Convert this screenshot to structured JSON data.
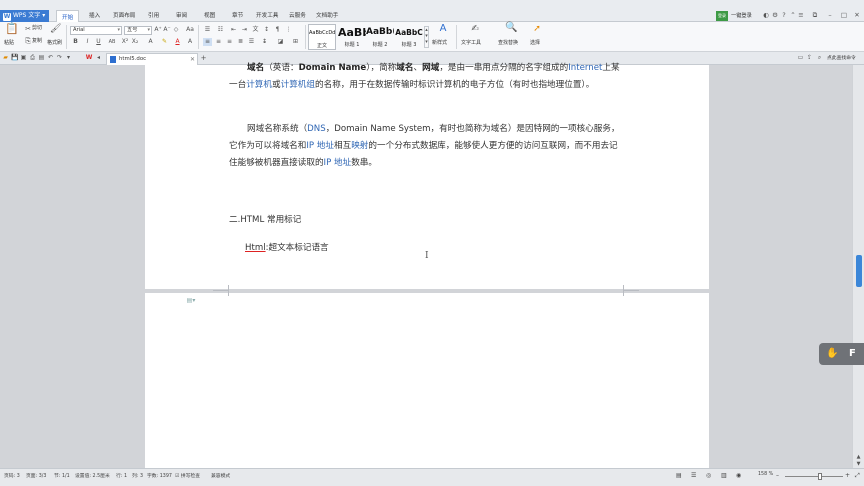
{
  "topbar": {
    "app_menu": "WPS 文字",
    "app_logo_letter": "W",
    "tabs": [
      "开始",
      "插入",
      "页面布局",
      "引用",
      "审阅",
      "视图",
      "章节",
      "开发工具",
      "云服务",
      "文档助手"
    ],
    "account_badge": "登录",
    "login_label": "一键登录"
  },
  "ribbon": {
    "paste": "粘贴",
    "cut": "剪切",
    "copy": "复制",
    "format_painter": "格式刷",
    "font_name": "Arial",
    "font_size": "五号",
    "styles": [
      {
        "sample": "AaBbCcDd",
        "name": "正文"
      },
      {
        "sample": "AaBb",
        "name": "标题 1"
      },
      {
        "sample": "AaBb(",
        "name": "标题 2"
      },
      {
        "sample": "AaBbC",
        "name": "标题 3"
      }
    ],
    "new_style": "新样式",
    "text_tools": "文字工具",
    "find_replace": "查找替换",
    "select": "选择"
  },
  "tabbar": {
    "doc_name": "html5.doc",
    "right_action": "点此查找命令"
  },
  "document": {
    "para1_term": "域名",
    "para1_p1": "（英语：",
    "para1_en": "Domain Name",
    "para1_p2": "），简称",
    "para1_b2": "域名",
    "para1_p3": "、",
    "para1_b3": "网域",
    "para1_p4": "，是由一串用点分隔的名字组成的",
    "para1_l1": "Internet",
    "para1_p5": "上某一台",
    "para1_l2": "计算机",
    "para1_p6": "或",
    "para1_l3": "计算机组",
    "para1_p7": "的名称，用于在数据传输时标识计算机的电子方位（有时也指地理位置）。",
    "para2_p1": "网域名称系统（",
    "para2_l1": "DNS",
    "para2_p2": "，Domain Name System，有时也简称为域名）是因特网的一项核心服务，它作为可以将域名和",
    "para2_l2": "IP 地址",
    "para2_p3": "相互",
    "para2_l3": "映射",
    "para2_p4": "的一个分布式数据库，能够使人更方便的访问互联网，而不用去记住能够被机器直接读取的",
    "para2_l4": "IP 地址",
    "para2_p5": "数串。",
    "heading": "二.HTML 常用标记",
    "item_term": "Html",
    "item_desc": ":超文本标记语言"
  },
  "float_button": {
    "icon": "hand-icon",
    "letter": "F"
  },
  "status": {
    "page": "页码: 3",
    "pages": "页面: 3/3",
    "section": "节: 1/1",
    "position": "设置值: 2.5厘米",
    "row": "行: 1",
    "col": "列: 3",
    "word_count": "字数: 1397",
    "spell": "拼写检查",
    "compat": "兼容模式",
    "zoom": "158 %"
  }
}
